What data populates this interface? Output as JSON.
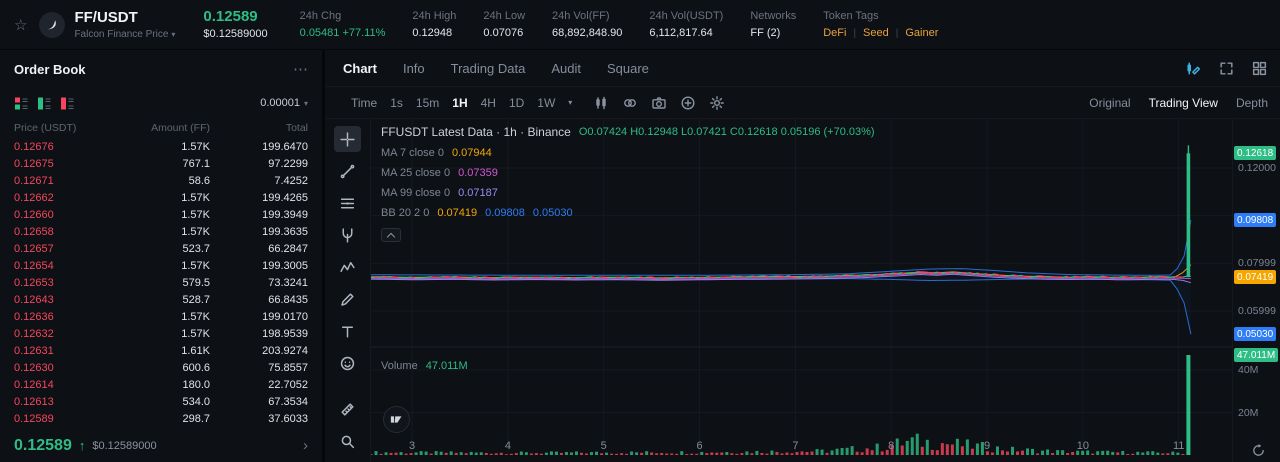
{
  "header": {
    "pair": "FF/USDT",
    "pair_subtitle": "Falcon Finance Price",
    "last_price": "0.12589",
    "last_price_usd": "$0.12589000",
    "stats": [
      {
        "label": "24h Chg",
        "value": "0.05481 +77.11%",
        "highlight": "green"
      },
      {
        "label": "24h High",
        "value": "0.12948"
      },
      {
        "label": "24h Low",
        "value": "0.07076"
      },
      {
        "label": "24h Vol(FF)",
        "value": "68,892,848.90"
      },
      {
        "label": "24h Vol(USDT)",
        "value": "6,112,817.64"
      },
      {
        "label": "Networks",
        "value": "FF (2)"
      }
    ],
    "token_tags_label": "Token Tags",
    "token_tags": [
      "DeFi",
      "Seed",
      "Gainer"
    ]
  },
  "order_book": {
    "title": "Order Book",
    "precision": "0.00001",
    "columns": [
      "Price (USDT)",
      "Amount (FF)",
      "Total"
    ],
    "asks": [
      [
        "0.12676",
        "1.57K",
        "199.6470"
      ],
      [
        "0.12675",
        "767.1",
        "97.2299"
      ],
      [
        "0.12671",
        "58.6",
        "7.4252"
      ],
      [
        "0.12662",
        "1.57K",
        "199.4265"
      ],
      [
        "0.12660",
        "1.57K",
        "199.3949"
      ],
      [
        "0.12658",
        "1.57K",
        "199.3635"
      ],
      [
        "0.12657",
        "523.7",
        "66.2847"
      ],
      [
        "0.12654",
        "1.57K",
        "199.3005"
      ],
      [
        "0.12653",
        "579.5",
        "73.3241"
      ],
      [
        "0.12643",
        "528.7",
        "66.8435"
      ],
      [
        "0.12636",
        "1.57K",
        "199.0170"
      ],
      [
        "0.12632",
        "1.57K",
        "198.9539"
      ],
      [
        "0.12631",
        "1.61K",
        "203.9274"
      ],
      [
        "0.12630",
        "600.6",
        "75.8557"
      ],
      [
        "0.12614",
        "180.0",
        "22.7052"
      ],
      [
        "0.12613",
        "534.0",
        "67.3534"
      ],
      [
        "0.12589",
        "298.7",
        "37.6033"
      ]
    ],
    "last_price": "0.12589",
    "last_price_usd": "$0.12589000"
  },
  "main_tabs": [
    "Chart",
    "Info",
    "Trading Data",
    "Audit",
    "Square"
  ],
  "active_tab": "Chart",
  "toolbar": {
    "time_label": "Time",
    "intervals": [
      "1s",
      "15m",
      "1H",
      "4H",
      "1D",
      "1W"
    ],
    "active_interval": "1H",
    "modes": [
      "Original",
      "Trading View",
      "Depth"
    ],
    "active_mode": "Trading View"
  },
  "icons": {
    "star": "☆",
    "more": "⋯",
    "caret_down": "▾",
    "chevron_right": "›",
    "arrow_up": "↑"
  },
  "chart_data": {
    "type": "candlestick",
    "title": "FFUSDT Latest Data · 1h · Binance",
    "ohlc": [
      {
        "k": "O",
        "v": "0.07424"
      },
      {
        "k": "H",
        "v": "0.12948"
      },
      {
        "k": "L",
        "v": "0.07421"
      },
      {
        "k": "C",
        "v": "0.12618"
      }
    ],
    "change": "0.05196 (+70.03%)",
    "indicators": [
      {
        "label": "MA 7 close 0",
        "values": [
          {
            "v": "0.07944",
            "color": "#f0a70a"
          }
        ]
      },
      {
        "label": "MA 25 close 0",
        "values": [
          {
            "v": "0.07359",
            "color": "#d357d3"
          }
        ]
      },
      {
        "label": "MA 99 close 0",
        "values": [
          {
            "v": "0.07187",
            "color": "#9b8cf5"
          }
        ]
      },
      {
        "label": "BB 20 2 0",
        "values": [
          {
            "v": "0.07419",
            "color": "#f0a70a"
          },
          {
            "v": "0.09808",
            "color": "#2e7df6"
          },
          {
            "v": "0.05030",
            "color": "#2e7df6"
          }
        ]
      }
    ],
    "volume_label": "Volume",
    "volume_value": "47.011M",
    "x_labels": [
      "3",
      "4",
      "5",
      "6",
      "7",
      "8",
      "9",
      "10",
      "11"
    ],
    "y_ticks": [
      {
        "text": "0.12000",
        "price": 0.12
      },
      {
        "text": "0.07999",
        "price": 0.07999
      },
      {
        "text": "0.05999",
        "price": 0.05999
      }
    ],
    "y_badges": [
      {
        "text": "0.12618",
        "price": 0.12618,
        "color": "#2ebd85"
      },
      {
        "text": "0.09808",
        "price": 0.09808,
        "color": "#2e7df6"
      },
      {
        "text": "0.07419",
        "price": 0.07419,
        "color": "#f7a600"
      },
      {
        "text": "0.05030",
        "price": 0.0503,
        "color": "#2e7df6"
      }
    ],
    "volume_axis": {
      "badge": {
        "text": "47.011M",
        "m": 47.011,
        "color": "#2ebd85"
      },
      "ticks": [
        {
          "text": "40M",
          "m": 40
        },
        {
          "text": "20M",
          "m": 20
        }
      ]
    },
    "grid_prices": [
      0.12,
      0.1,
      0.08,
      0.06
    ],
    "price_anchors": [
      [
        0,
        0.0744
      ],
      [
        0.05,
        0.0741
      ],
      [
        0.1,
        0.0743
      ],
      [
        0.15,
        0.074
      ],
      [
        0.2,
        0.0742
      ],
      [
        0.25,
        0.074
      ],
      [
        0.3,
        0.0742
      ],
      [
        0.35,
        0.0739
      ],
      [
        0.4,
        0.0741
      ],
      [
        0.45,
        0.0743
      ],
      [
        0.5,
        0.0744
      ],
      [
        0.55,
        0.0746
      ],
      [
        0.6,
        0.075
      ],
      [
        0.64,
        0.0757
      ],
      [
        0.67,
        0.0763
      ],
      [
        0.69,
        0.076
      ],
      [
        0.71,
        0.0764
      ],
      [
        0.73,
        0.0759
      ],
      [
        0.76,
        0.0752
      ],
      [
        0.79,
        0.0747
      ],
      [
        0.82,
        0.0744
      ],
      [
        0.85,
        0.0742
      ],
      [
        0.88,
        0.0744
      ],
      [
        0.91,
        0.0741
      ],
      [
        0.94,
        0.0742
      ],
      [
        0.965,
        0.0744
      ],
      [
        0.98,
        0.0742
      ],
      [
        0.993,
        0.0744
      ]
    ],
    "bb_upper": [
      [
        0,
        0.0752
      ],
      [
        0.1,
        0.0751
      ],
      [
        0.2,
        0.075
      ],
      [
        0.3,
        0.075
      ],
      [
        0.4,
        0.075
      ],
      [
        0.5,
        0.0752
      ],
      [
        0.58,
        0.0756
      ],
      [
        0.64,
        0.0768
      ],
      [
        0.68,
        0.0776
      ],
      [
        0.72,
        0.0778
      ],
      [
        0.76,
        0.077
      ],
      [
        0.8,
        0.076
      ],
      [
        0.85,
        0.0753
      ],
      [
        0.9,
        0.0751
      ],
      [
        0.95,
        0.075
      ],
      [
        0.975,
        0.0751
      ],
      [
        0.99,
        0.08
      ],
      [
        1,
        0.0981
      ]
    ],
    "bb_lower": [
      [
        0,
        0.0734
      ],
      [
        0.1,
        0.0733
      ],
      [
        0.2,
        0.0733
      ],
      [
        0.3,
        0.0731
      ],
      [
        0.4,
        0.0732
      ],
      [
        0.5,
        0.0734
      ],
      [
        0.58,
        0.0736
      ],
      [
        0.64,
        0.0732
      ],
      [
        0.68,
        0.0728
      ],
      [
        0.72,
        0.0729
      ],
      [
        0.76,
        0.0732
      ],
      [
        0.8,
        0.0734
      ],
      [
        0.85,
        0.0733
      ],
      [
        0.9,
        0.0732
      ],
      [
        0.95,
        0.0731
      ],
      [
        0.975,
        0.0729
      ],
      [
        0.99,
        0.066
      ],
      [
        1,
        0.0503
      ]
    ],
    "volume_profile": [
      [
        0,
        1.2
      ],
      [
        0.2,
        1.0
      ],
      [
        0.4,
        1.3
      ],
      [
        0.55,
        1.8
      ],
      [
        0.62,
        3.5
      ],
      [
        0.66,
        6.5
      ],
      [
        0.7,
        5.5
      ],
      [
        0.74,
        4.0
      ],
      [
        0.78,
        2.5
      ],
      [
        0.84,
        1.6
      ],
      [
        0.9,
        1.3
      ],
      [
        0.96,
        1.1
      ],
      [
        1,
        1.0
      ]
    ],
    "last_candle": {
      "f": 0.997,
      "open": 0.07424,
      "high": 0.12948,
      "low": 0.07421,
      "close": 0.12618,
      "volume_m": 47.011,
      "direction": "up"
    },
    "ma_end_values": {
      "ma7": 0.07944,
      "ma25": 0.07359,
      "ma99": 0.07187
    },
    "colors": {
      "up": "#2ebd85",
      "down": "#f6465d",
      "bb": "#2e7df6",
      "ma7": "#f0a70a",
      "ma25": "#d357d3",
      "ma99": "#9b8cf5"
    }
  }
}
